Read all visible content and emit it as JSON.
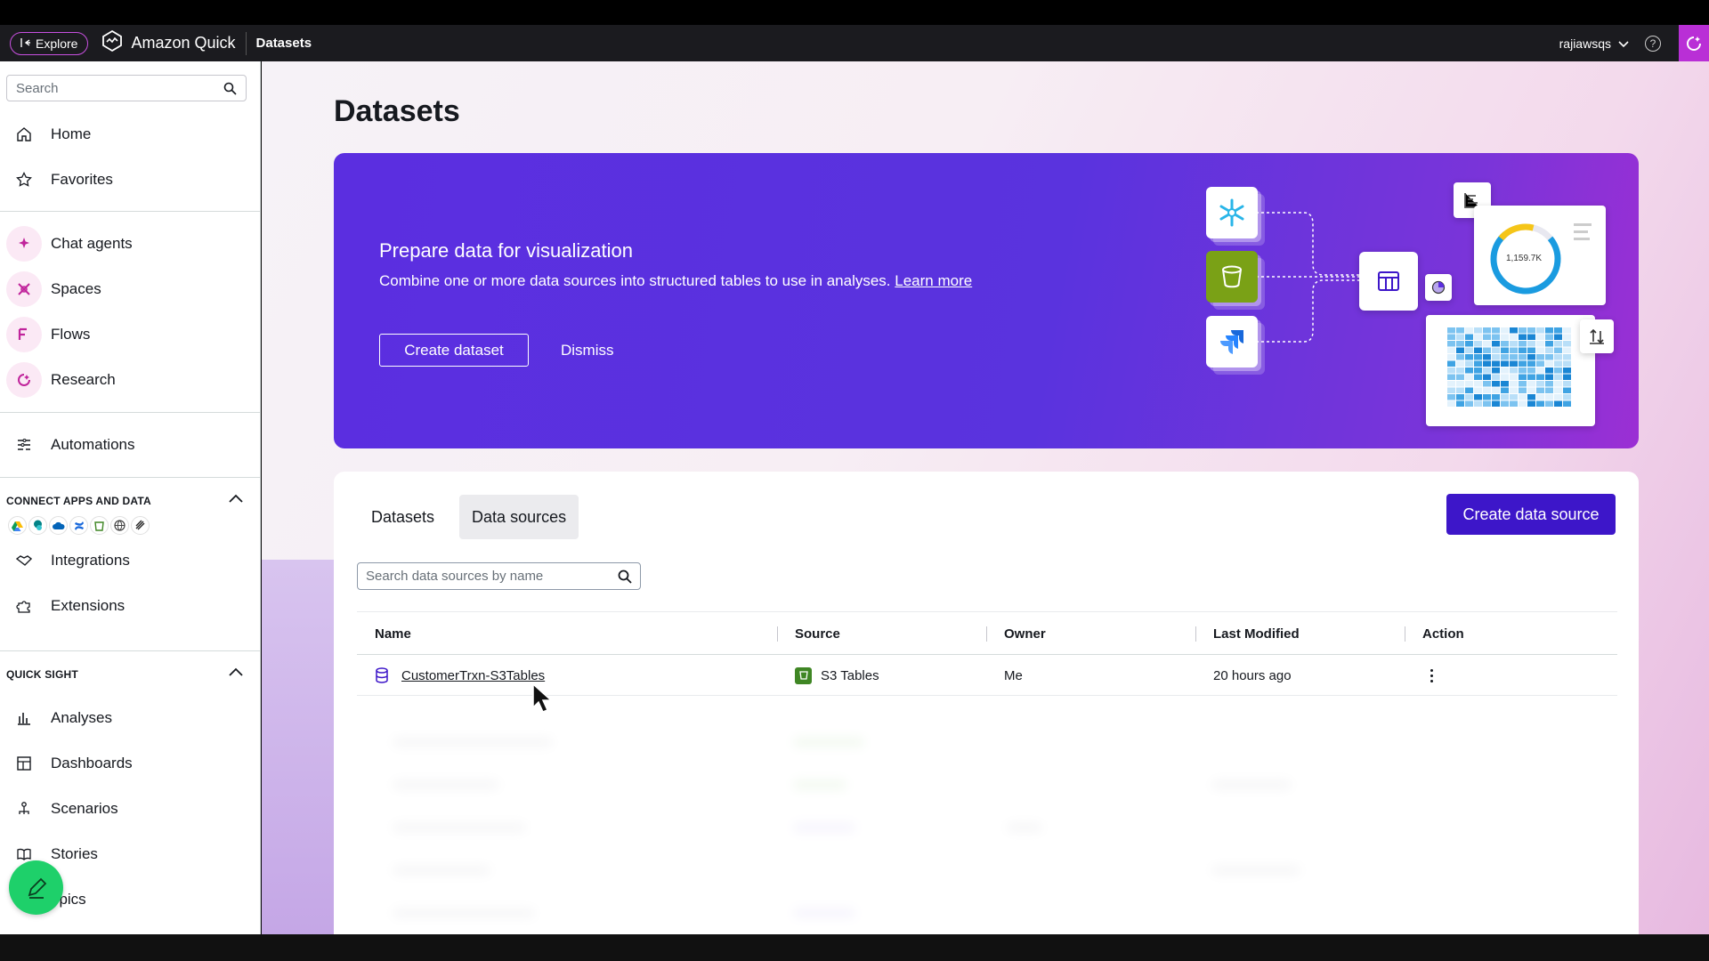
{
  "topbar": {
    "explore_label": "Explore",
    "brand": "Amazon Quick",
    "breadcrumb": "Datasets",
    "username": "rajiawsqs"
  },
  "sidebar": {
    "search_placeholder": "Search",
    "items_top": [
      {
        "label": "Home",
        "icon": "home-icon"
      },
      {
        "label": "Favorites",
        "icon": "star-icon"
      }
    ],
    "items_ai": [
      {
        "label": "Chat agents",
        "icon": "sparkle-icon"
      },
      {
        "label": "Spaces",
        "icon": "spaces-icon"
      },
      {
        "label": "Flows",
        "icon": "flows-icon"
      },
      {
        "label": "Research",
        "icon": "research-icon"
      }
    ],
    "automations": "Automations",
    "connect_section": "CONNECT APPS AND DATA",
    "connect_items": [
      "Integrations",
      "Extensions"
    ],
    "quicksight_section": "QUICK SIGHT",
    "quicksight_items": [
      "Analyses",
      "Dashboards",
      "Scenarios",
      "Stories",
      "opics"
    ]
  },
  "main": {
    "title": "Datasets",
    "hero": {
      "title": "Prepare data for visualization",
      "description": "Combine one or more data sources into structured tables to use in analyses.",
      "learn_more": "Learn more",
      "create_button": "Create dataset",
      "dismiss_button": "Dismiss",
      "gauge_value": "1,159.7K"
    },
    "tabs": [
      "Datasets",
      "Data sources"
    ],
    "active_tab": "Data sources",
    "create_source_button": "Create data source",
    "search_placeholder": "Search data sources by name",
    "table": {
      "columns": [
        "Name",
        "Source",
        "Owner",
        "Last Modified",
        "Action"
      ],
      "rows": [
        {
          "name": "CustomerTrxn-S3Tables",
          "source": "S3 Tables",
          "owner": "Me",
          "modified": "20 hours ago"
        }
      ]
    }
  },
  "colors": {
    "accent": "#3d16c9",
    "hero_bg": "#5b2ee0",
    "fab": "#1ed06a",
    "assistant": "#b92fd6"
  }
}
